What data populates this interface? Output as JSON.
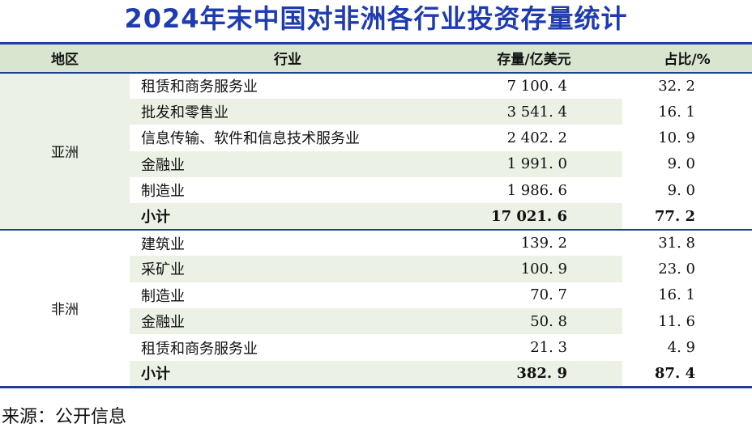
{
  "title": "2024年末中国对非洲各行业投资存量统计",
  "headers": [
    "地区",
    "行业",
    "存量/亿美元",
    "占比/%"
  ],
  "groups": [
    {
      "region": "亚洲",
      "rows": [
        {
          "industry": "租赁和商务服务业",
          "stock": "7 100. 4",
          "share": "32. 2"
        },
        {
          "industry": "批发和零售业",
          "stock": "3 541. 4",
          "share": "16. 1"
        },
        {
          "industry": "信息传输、软件和信息技术服务业",
          "stock": "2 402. 2",
          "share": "10. 9"
        },
        {
          "industry": "金融业",
          "stock": "1 991. 0",
          "share": "9. 0"
        },
        {
          "industry": "制造业",
          "stock": "1 986. 6",
          "share": "9. 0"
        },
        {
          "industry": "小计",
          "stock": "17 021. 6",
          "share": "77. 2"
        }
      ]
    },
    {
      "region": "非洲",
      "rows": [
        {
          "industry": "建筑业",
          "stock": "139. 2",
          "share": "31. 8"
        },
        {
          "industry": "采矿业",
          "stock": "100. 9",
          "share": "23. 0"
        },
        {
          "industry": "制造业",
          "stock": "70. 7",
          "share": "16. 1"
        },
        {
          "industry": "金融业",
          "stock": "50. 8",
          "share": "11. 6"
        },
        {
          "industry": "租赁和商务服务业",
          "stock": "21. 3",
          "share": "4. 9"
        },
        {
          "industry": "小计",
          "stock": "382. 9",
          "share": "87. 4"
        }
      ]
    }
  ],
  "source": "来源：公开信息"
}
